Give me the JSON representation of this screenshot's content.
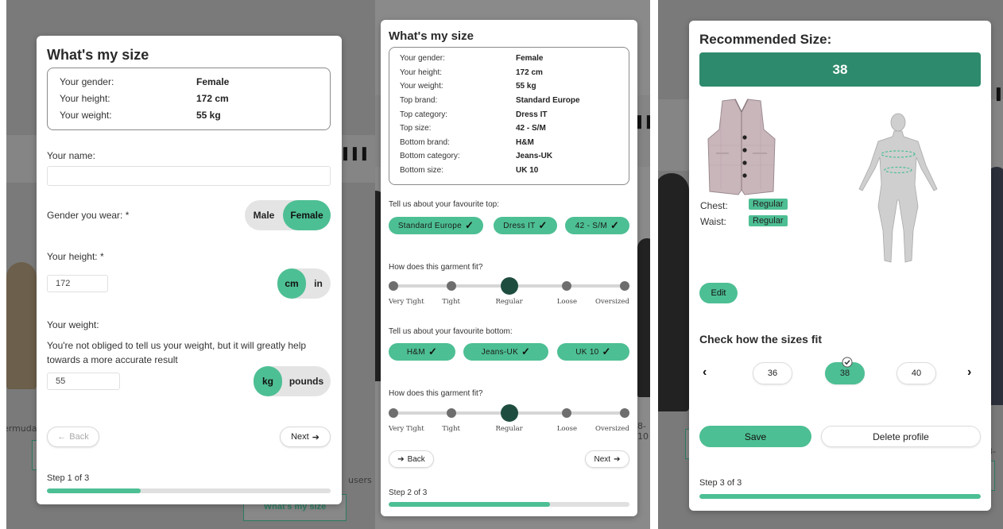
{
  "colors": {
    "accent": "#4dbf94",
    "accent_dark": "#2e8a6c",
    "slider_active": "#1e4d40"
  },
  "background": {
    "left_text": "ermuda",
    "mid_text": "users",
    "right_text_1": "8-10",
    "right_text_2": "8-",
    "button_label": "What's my size"
  },
  "step1": {
    "title": "What's my size",
    "summary": [
      {
        "label": "Your gender:",
        "value": "Female"
      },
      {
        "label": "Your height:",
        "value": "172 cm"
      },
      {
        "label": "Your weight:",
        "value": "55 kg"
      }
    ],
    "name_label": "Your name:",
    "name_value": "",
    "gender_label": "Gender you wear: *",
    "gender_options": [
      "Male",
      "Female"
    ],
    "gender_selected": "Female",
    "height_label": "Your height: *",
    "height_value": "172",
    "height_units": [
      "cm",
      "in"
    ],
    "height_unit_selected": "cm",
    "weight_label": "Your weight:",
    "weight_note": "You're not obliged to tell us your weight, but it will greatly help towards a more accurate result",
    "weight_value": "55",
    "weight_units": [
      "kg",
      "pounds"
    ],
    "weight_unit_selected": "kg",
    "back_label": "Back",
    "next_label": "Next",
    "step_text": "Step 1 of 3",
    "progress": 0.33
  },
  "step2": {
    "title": "What's my size",
    "summary": [
      {
        "label": "Your gender:",
        "value": "Female"
      },
      {
        "label": "Your height:",
        "value": "172 cm"
      },
      {
        "label": "Your weight:",
        "value": "55 kg"
      },
      {
        "label": "Top brand:",
        "value": "Standard Europe"
      },
      {
        "label": "Top category:",
        "value": "Dress IT"
      },
      {
        "label": "Top size:",
        "value": "42 - S/M"
      },
      {
        "label": "Bottom brand:",
        "value": "H&M"
      },
      {
        "label": "Bottom category:",
        "value": "Jeans-UK"
      },
      {
        "label": "Bottom size:",
        "value": "UK 10"
      }
    ],
    "top_heading": "Tell us about your favourite top:",
    "top_chips": [
      "Standard Europe",
      "Dress IT",
      "42 - S/M"
    ],
    "fit_question": "How does this garment fit?",
    "fit_levels": [
      "Very Tight",
      "Tight",
      "Regular",
      "Loose",
      "Oversized"
    ],
    "top_fit_selected": "Regular",
    "bottom_heading": "Tell us about your favourite bottom:",
    "bottom_chips": [
      "H&M",
      "Jeans-UK",
      "UK 10"
    ],
    "bottom_fit_selected": "Regular",
    "back_label": "Back",
    "next_label": "Next",
    "step_text": "Step 2 of 3",
    "progress": 0.67
  },
  "step3": {
    "title": "Recommended Size:",
    "recommended_size": "38",
    "fit_rows": [
      {
        "label": "Chest:",
        "value": "Regular"
      },
      {
        "label": "Waist:",
        "value": "Regular"
      }
    ],
    "edit_label": "Edit",
    "check_heading": "Check how the sizes fit",
    "sizes": [
      "36",
      "38",
      "40"
    ],
    "selected_size": "38",
    "save_label": "Save",
    "delete_label": "Delete profile",
    "step_text": "Step 3 of 3",
    "progress": 1.0
  }
}
